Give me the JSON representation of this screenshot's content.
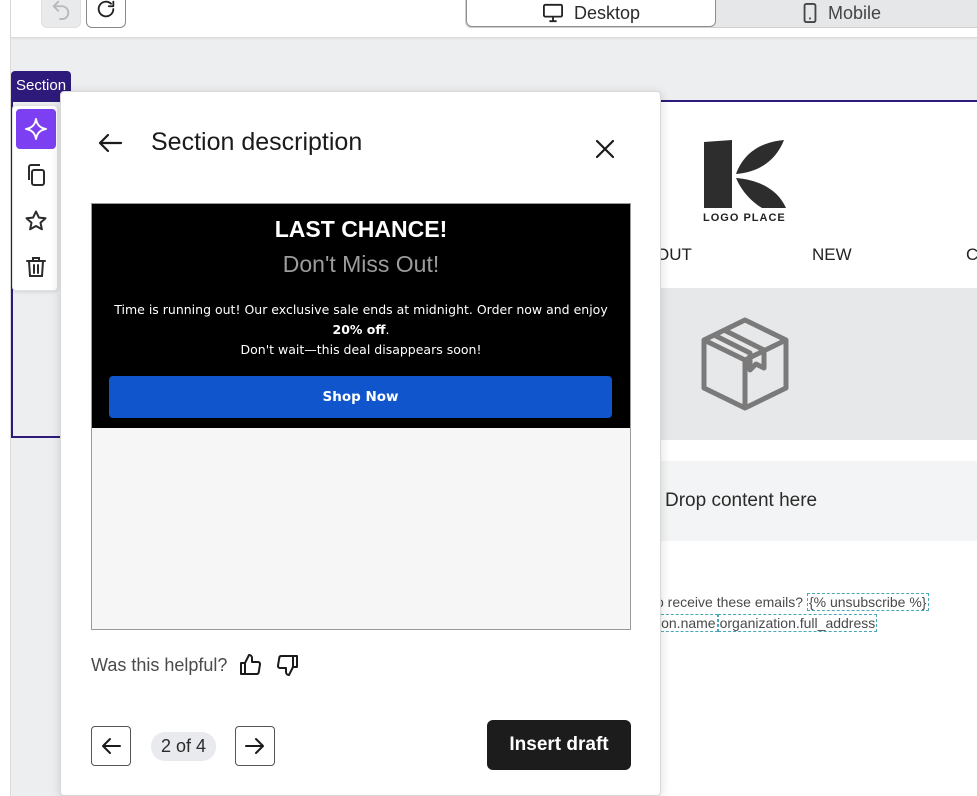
{
  "toolbar": {
    "undo_icon": "undo-icon",
    "redo_icon": "redo-icon",
    "device_options": [
      {
        "label": "Desktop",
        "icon": "monitor-icon",
        "selected": true
      },
      {
        "label": "Mobile",
        "icon": "phone-icon",
        "selected": false
      }
    ]
  },
  "section": {
    "label": "Section",
    "tools": [
      "sparkle-icon",
      "copy-icon",
      "star-icon",
      "trash-icon"
    ],
    "accent_color": "#2e1a7a",
    "ai_color": "#7c3ff2"
  },
  "email": {
    "logo_text": "LOGO PLACE",
    "nav": [
      "OUT",
      "NEW",
      "C"
    ],
    "hero_icon": "box-icon",
    "drop_text": "Drop content here",
    "footer_line1_prefix": "o receive these emails?",
    "footer_tag1": "{% unsubscribe %}",
    "footer_line2_tag1": "ion.name",
    "footer_line2_tag2": "organization.full_address"
  },
  "modal": {
    "title": "Section description",
    "preview": {
      "heading": "LAST CHANCE!",
      "subheading": "Don't Miss Out!",
      "body_part1": "Time is running out! Our exclusive sale ends at midnight. Order now and enjoy ",
      "body_bold": "20% off",
      "body_part2": ".",
      "body_line2": "Don't wait—this deal disappears soon!",
      "button_label": "Shop Now",
      "button_color": "#1155cc"
    },
    "helpful_label": "Was this helpful?",
    "pagination": "2 of 4",
    "insert_label": "Insert draft"
  }
}
